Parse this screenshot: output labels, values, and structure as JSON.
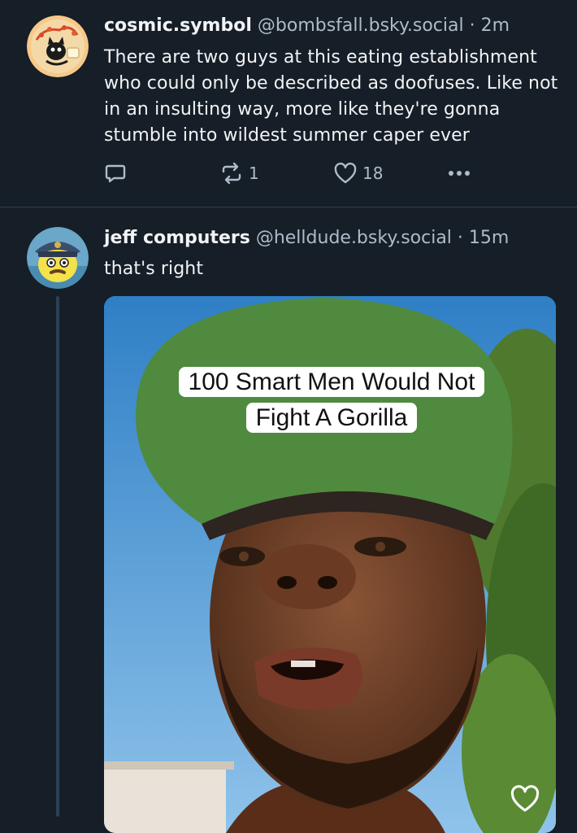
{
  "posts": [
    {
      "display_name": "cosmic.symbol",
      "handle": "@bombsfall.bsky.social",
      "separator": "·",
      "time": "2m",
      "text": "There are two guys at this eating establishment who could only be described as doofuses. Like not in an insulting way, more like they're gonna stumble into wildest summer caper ever",
      "avatar_icon": "cartoon-cat-avatar",
      "actions": {
        "reply_icon": "reply-icon",
        "repost_icon": "repost-icon",
        "repost_count": "1",
        "like_icon": "heart-icon",
        "like_count": "18",
        "more_icon": "more-dots-icon"
      }
    },
    {
      "display_name": "jeff computers",
      "handle": "@helldude.bsky.social",
      "separator": "·",
      "time": "15m",
      "text": "that's right",
      "avatar_icon": "cartoon-captain-avatar",
      "media": {
        "caption_line1": "100 Smart Men Would Not",
        "caption_line2": "Fight A Gorilla",
        "overlay_icon": "heart-icon"
      }
    }
  ],
  "colors": {
    "background": "#161e27",
    "text": "#f1f3f5",
    "muted": "#aebbc9",
    "divider": "#2e4052"
  }
}
